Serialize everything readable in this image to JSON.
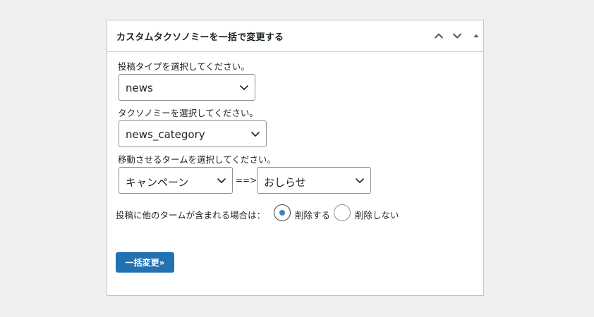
{
  "panel": {
    "title": "カスタムタクソノミーを一括で変更する",
    "controls": [
      "chevron-up-icon",
      "chevron-down-icon",
      "triangle-up-icon"
    ]
  },
  "post_type": {
    "label": "投稿タイプを選択してください。",
    "selected": "news"
  },
  "taxonomy": {
    "label": "タクソノミーを選択してください。",
    "selected": "news_category"
  },
  "move_terms": {
    "label": "移動させるタームを選択してください。",
    "from_selected": "キャンペーン",
    "arrow": "==>",
    "to_selected": "おしらせ"
  },
  "other_terms": {
    "question": "投稿に他のタームが含まれる場合は：",
    "options": [
      {
        "label": "削除する",
        "checked": true
      },
      {
        "label": "削除しない",
        "checked": false
      }
    ]
  },
  "submit": {
    "label": "一括変更»"
  },
  "colors": {
    "primary": "#2271b1",
    "radio_dot": "#3582c4",
    "border": "#c3c4c7",
    "background": "#f0f0f1"
  }
}
